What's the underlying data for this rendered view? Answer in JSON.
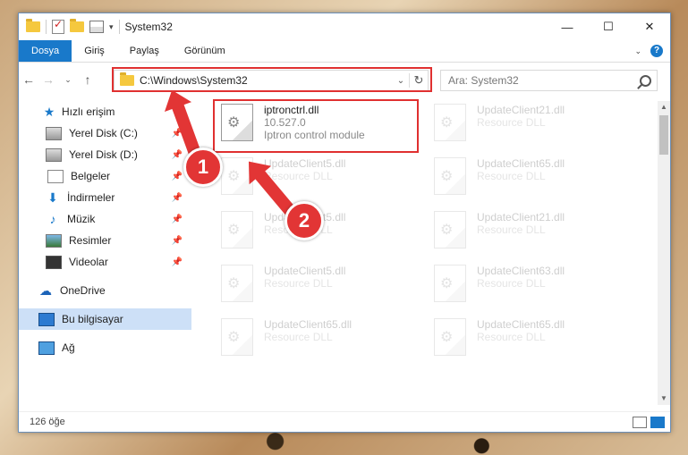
{
  "window": {
    "title": "System32"
  },
  "ribbon": {
    "tabs": [
      "Dosya",
      "Giriş",
      "Paylaş",
      "Görünüm"
    ]
  },
  "address": {
    "path": "C:\\Windows\\System32"
  },
  "search": {
    "placeholder": "Ara: System32"
  },
  "nav": {
    "items": [
      {
        "label": "Hızlı erişim"
      },
      {
        "label": "Yerel Disk (C:)"
      },
      {
        "label": "Yerel Disk (D:)"
      },
      {
        "label": "Belgeler"
      },
      {
        "label": "İndirmeler"
      },
      {
        "label": "Müzik"
      },
      {
        "label": "Resimler"
      },
      {
        "label": "Videolar"
      },
      {
        "label": "OneDrive"
      },
      {
        "label": "Bu bilgisayar"
      },
      {
        "label": "Ağ"
      }
    ]
  },
  "files": {
    "main": {
      "name": "iptronctrl.dll",
      "version": "10.527.0",
      "description": "Iptron control module"
    },
    "ghosts": [
      {
        "name": "UpdateClient21.dll",
        "type": "Resource DLL"
      },
      {
        "name": "UpdateClient5.dll",
        "type": "Resource DLL"
      },
      {
        "name": "UpdateClient65.dll",
        "type": "Resource DLL"
      },
      {
        "name": "UpdateClient5.dll",
        "type": "Resource DLL"
      },
      {
        "name": "UpdateClient21.dll",
        "type": "Resource DLL"
      },
      {
        "name": "UpdateClient5.dll",
        "type": "Resource DLL"
      },
      {
        "name": "UpdateClient63.dll",
        "type": "Resource DLL"
      },
      {
        "name": "UpdateClient65.dll",
        "type": "Resource DLL"
      },
      {
        "name": "UpdateClient65.dll",
        "type": "Resource DLL"
      }
    ]
  },
  "status": {
    "count": "126 öğe"
  },
  "annotations": {
    "badge1": "1",
    "badge2": "2",
    "color": "#e23535"
  }
}
